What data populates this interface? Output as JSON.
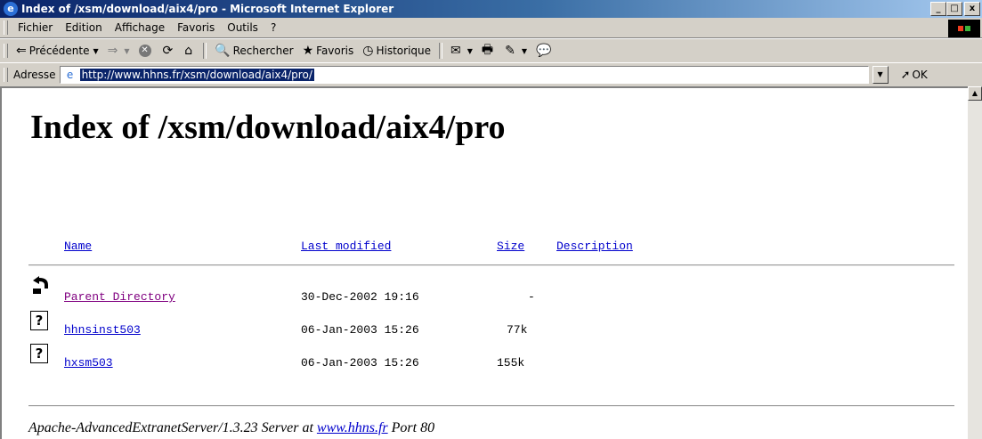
{
  "window": {
    "title": "Index of /xsm/download/aix4/pro - Microsoft Internet Explorer",
    "min_label": "_",
    "max_label": "□",
    "close_label": "x"
  },
  "menubar": {
    "items": [
      "Fichier",
      "Edition",
      "Affichage",
      "Favoris",
      "Outils",
      "?"
    ]
  },
  "toolbar": {
    "back_label": "Précédente",
    "search_label": "Rechercher",
    "favorites_label": "Favoris",
    "history_label": "Historique"
  },
  "addressbar": {
    "label": "Adresse",
    "url": "http://www.hhns.fr/xsm/download/aix4/pro/",
    "go_label": "OK"
  },
  "page": {
    "title": "Index of /xsm/download/aix4/pro",
    "columns": {
      "name": "Name",
      "modified": "Last modified",
      "size": "Size",
      "description": "Description"
    },
    "rows": [
      {
        "name": "Parent Directory",
        "modified": "30-Dec-2002 19:16",
        "size": "-",
        "icon": "back-arrow-icon"
      },
      {
        "name": "hhnsinst503",
        "modified": "06-Jan-2003 15:26",
        "size": "77k",
        "icon": "unknown-file-icon"
      },
      {
        "name": "hxsm503",
        "modified": "06-Jan-2003 15:26",
        "size": "155k",
        "icon": "unknown-file-icon"
      }
    ],
    "footer": {
      "prefix": "Apache-AdvancedExtranetServer/1.3.23 Server at ",
      "host": "www.hhns.fr",
      "suffix": " Port 80"
    }
  },
  "colors": {
    "titlebar_start": "#0a246a",
    "titlebar_end": "#a6caf0",
    "link": "#0000cc",
    "visited_link": "#800080"
  }
}
